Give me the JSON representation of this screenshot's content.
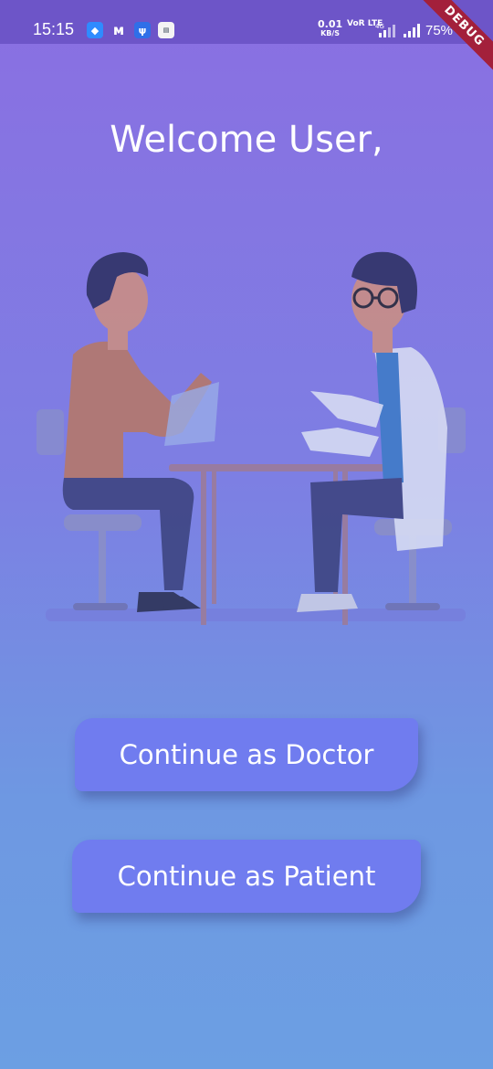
{
  "status_bar": {
    "time": "15:15",
    "net_speed": "0.01",
    "net_unit": "KB/S",
    "volte": "VoR LTE",
    "network": "4G",
    "battery": "75%",
    "notification_icons": [
      "android-icon",
      "myntra-icon",
      "usb-icon",
      "app-icon"
    ]
  },
  "debug_banner": "DEBUG",
  "welcome_title": "Welcome User,",
  "buttons": {
    "doctor": "Continue as Doctor",
    "patient": "Continue as Patient"
  },
  "colors": {
    "button": "#707cef",
    "gradient_top": "#8a6fe2",
    "gradient_bottom": "#6c9fe3",
    "debug_banner": "#a3203b"
  }
}
